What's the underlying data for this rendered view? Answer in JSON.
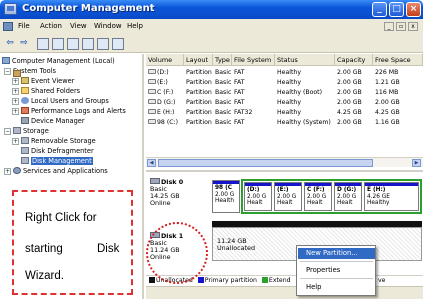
{
  "window": {
    "title": "Computer Management",
    "controls": {
      "minimize": "_",
      "maximize": "□",
      "close": "×"
    }
  },
  "menubar": {
    "items": [
      "File",
      "Action",
      "View",
      "Window",
      "Help"
    ],
    "mdi_controls": {
      "minimize": "_",
      "restore": "▫",
      "close": "x"
    }
  },
  "toolbar": {
    "buttons": [
      "back-icon",
      "forward-icon",
      "up-icon",
      "show-hide-tree-icon",
      "refresh-icon",
      "export-icon",
      "help-icon",
      "properties-icon"
    ],
    "back_glyph": "⇦",
    "forward_glyph": "⇨"
  },
  "tree": {
    "root": "Computer Management (Local)",
    "system_tools": "System Tools",
    "event_viewer": "Event Viewer",
    "shared_folders": "Shared Folders",
    "local_users": "Local Users and Groups",
    "perf_logs": "Performance Logs and Alerts",
    "device_manager": "Device Manager",
    "storage": "Storage",
    "removable_storage": "Removable Storage",
    "disk_defrag": "Disk Defragmenter",
    "disk_management": "Disk Management",
    "services": "Services and Applications",
    "expander_plus": "+",
    "expander_minus": "−"
  },
  "callout": {
    "line1": "Right Click for",
    "line2a": "starting",
    "line2b": "Disk",
    "line3": "Wizard."
  },
  "volume_list": {
    "headers": [
      "Volume",
      "Layout",
      "Type",
      "File System",
      "Status",
      "Capacity",
      "Free Space"
    ],
    "rows": [
      [
        "(D:)",
        "Partition",
        "Basic",
        "FAT",
        "Healthy",
        "2.00 GB",
        "226 MB"
      ],
      [
        "(E:)",
        "Partition",
        "Basic",
        "FAT",
        "Healthy",
        "2.00 GB",
        "1.21 GB"
      ],
      [
        "C (F:)",
        "Partition",
        "Basic",
        "FAT",
        "Healthy (Boot)",
        "2.00 GB",
        "116 MB"
      ],
      [
        "D (G:)",
        "Partition",
        "Basic",
        "FAT",
        "Healthy",
        "2.00 GB",
        "2.00 GB"
      ],
      [
        "E (H:)",
        "Partition",
        "Basic",
        "FAT32",
        "Healthy",
        "4.25 GB",
        "4.25 GB"
      ],
      [
        "98 (C:)",
        "Partition",
        "Basic",
        "FAT",
        "Healthy (System)",
        "2.00 GB",
        "1.16 GB"
      ]
    ]
  },
  "disks": {
    "disk0": {
      "name": "Disk 0",
      "type": "Basic",
      "size": "14.25 GB",
      "status": "Online"
    },
    "disk1": {
      "name": "Disk 1",
      "type": "Basic",
      "size": "11.24 GB",
      "status": "Online"
    },
    "disk0_partitions": [
      {
        "label": "98  (C",
        "size": "2.00 G",
        "status": "Health"
      },
      {
        "label": "(D:)",
        "size": "2.00 G",
        "status": "Healt"
      },
      {
        "label": "(E:)",
        "size": "2.00 G",
        "status": "Healt"
      },
      {
        "label": "C  (F:)",
        "size": "2.00 G",
        "status": "Healt"
      },
      {
        "label": "D  (G:)",
        "size": "2.00 G",
        "status": "Healt"
      },
      {
        "label": "E  (H:)",
        "size": "4.26 GE",
        "status": "Healthy"
      }
    ],
    "disk1_unallocated": {
      "size": "11.24 GB",
      "label": "Unallocated"
    }
  },
  "legend": {
    "items": [
      {
        "label": "Unallocated",
        "color": "#111111"
      },
      {
        "label": "Primary partition",
        "color": "#1414cc"
      },
      {
        "label": "Extend",
        "color": "#2ca02c"
      }
    ],
    "tail": "ve"
  },
  "context_menu": {
    "items": [
      "New Partition...",
      "Properties",
      "Help"
    ]
  },
  "colors": {
    "selection": "#316ac5",
    "primary_partition": "#1414cc",
    "extended_partition": "#2ca02c",
    "annotation": "#e03030"
  }
}
